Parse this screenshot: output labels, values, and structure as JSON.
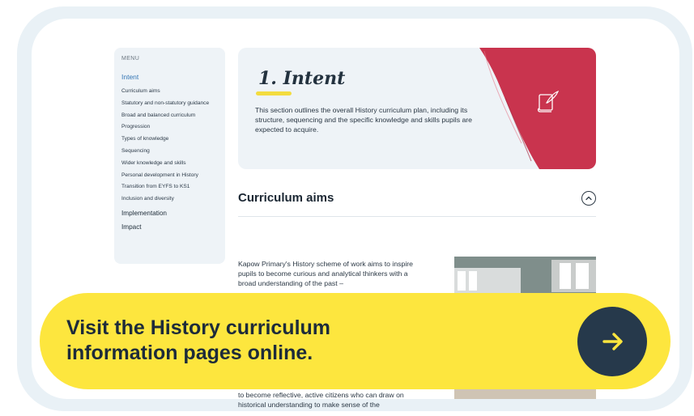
{
  "sidebar": {
    "menu_label": "MENU",
    "active": "Intent",
    "sub_items": [
      "Curriculum aims",
      "Statutory and non-statutory guidance",
      "Broad and balanced curriculum",
      "Progression",
      "Types of knowledge",
      "Sequencing",
      "Wider knowledge and skills",
      "Personal development in History",
      "Transition from EYFS to KS1",
      "Inclusion and diversity"
    ],
    "main_items": [
      "Implementation",
      "Impact"
    ]
  },
  "hero": {
    "title": "1. Intent",
    "description": "This section outlines the overall History curriculum plan, including its structure, sequencing and the specific knowledge and skills pupils are expected to acquire.",
    "icon": "scroll-quill-icon"
  },
  "section": {
    "title": "Curriculum aims",
    "toggle_icon": "chevron-up-icon",
    "paragraph_top": "Kapow Primary's History scheme of work aims to inspire pupils to become curious and analytical thinkers with a broad understanding of the past –",
    "paragraph_bottom": "to become reflective, active citizens who can draw on historical understanding to make sense of the"
  },
  "cta": {
    "text": "Visit the History curriculum information pages online.",
    "icon": "arrow-right-icon"
  },
  "colors": {
    "accent_yellow": "#fde63e",
    "brand_red": "#c9344e",
    "navy": "#26394b",
    "link_blue": "#3476b5"
  }
}
